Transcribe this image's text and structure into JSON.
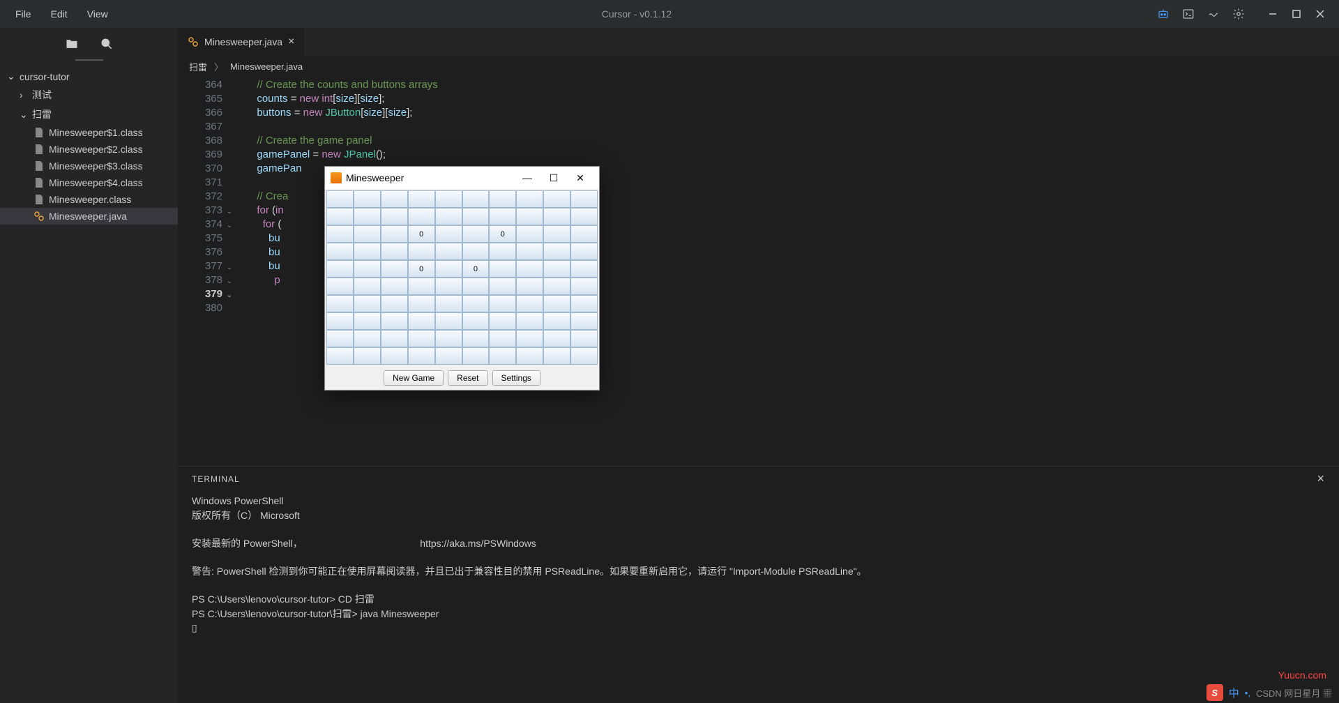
{
  "app": {
    "title": "Cursor - v0.1.12"
  },
  "menu": {
    "file": "File",
    "edit": "Edit",
    "view": "View"
  },
  "sidebar": {
    "root": "cursor-tutor",
    "folders": {
      "test": "测试",
      "saolei": "扫雷"
    },
    "files": {
      "f1": "Minesweeper$1.class",
      "f2": "Minesweeper$2.class",
      "f3": "Minesweeper$3.class",
      "f4": "Minesweeper$4.class",
      "f5": "Minesweeper.class",
      "f6": "Minesweeper.java"
    }
  },
  "tab": {
    "name": "Minesweeper.java"
  },
  "breadcrumb": {
    "p1": "扫雷",
    "p2": "Minesweeper.java"
  },
  "code": {
    "lines": [
      "364",
      "365",
      "366",
      "367",
      "368",
      "369",
      "370",
      "371",
      "372",
      "373",
      "374",
      "375",
      "376",
      "377",
      "378",
      "379",
      "380"
    ],
    "l364": "// Create the counts and buttons arrays",
    "l365a": "counts",
    "l365b": " = ",
    "l365c": "new",
    "l365d": " int",
    "l365e": "[",
    "l365f": "size",
    "l365g": "][",
    "l365h": "size",
    "l365i": "];",
    "l366a": "buttons",
    "l366b": " = ",
    "l366c": "new",
    "l366d": " JButton",
    "l366e": "[",
    "l366f": "size",
    "l366g": "][",
    "l366h": "size",
    "l366i": "];",
    "l368": "// Create the game panel",
    "l369a": "gam",
    "l369b": "ePanel",
    "l369c": " = ",
    "l369d": "new",
    "l369e": " JPanel",
    "l369f": "();",
    "l370a": "gam",
    "l370b": "ePan",
    "l372": "// Crea",
    "l373a": "for",
    "l373b": " (",
    "l373c": "in",
    "l374a": "for",
    "l374b": " (",
    "l375": "bu",
    "l376": "bu",
    "l377": "bu",
    "l378": "p"
  },
  "terminal": {
    "label": "TERMINAL",
    "line1": "Windows PowerShell",
    "line2": "版权所有（C） Microsoft",
    "line3": "安装最新的 PowerShell，",
    "line3b": "https://aka.ms/PSWindows",
    "line4": "警告: PowerShell 检测到你可能正在使用屏幕阅读器，并且已出于兼容性目的禁用 PSReadLine。如果要重新启用它，请运行 \"Import-Module PSReadLine\"。",
    "line5": "PS C:\\Users\\lenovo\\cursor-tutor> CD 扫雷",
    "line6": "PS C:\\Users\\lenovo\\cursor-tutor\\扫雷> java Minesweeper",
    "cursor": "▯"
  },
  "minesweeper": {
    "title": "Minesweeper",
    "rows": 10,
    "cols": 10,
    "revealed": [
      {
        "r": 2,
        "c": 3,
        "v": "0"
      },
      {
        "r": 2,
        "c": 6,
        "v": "0"
      },
      {
        "r": 4,
        "c": 3,
        "v": "0"
      },
      {
        "r": 4,
        "c": 5,
        "v": "0"
      }
    ],
    "buttons": {
      "new": "New Game",
      "reset": "Reset",
      "settings": "Settings"
    },
    "win": {
      "min": "—",
      "max": "☐",
      "close": "✕"
    }
  },
  "watermark": "Yuucn.com",
  "tray": {
    "zh": "中",
    "dot": "•,",
    "rest": "CSDN 网日星月 ▦"
  }
}
